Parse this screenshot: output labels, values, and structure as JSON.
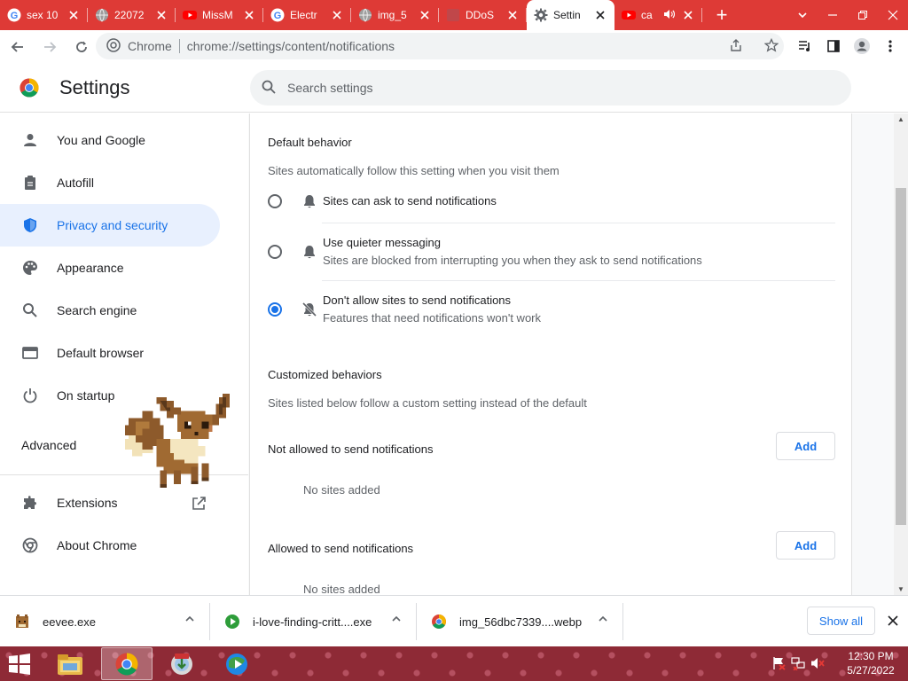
{
  "tabs": [
    {
      "title": "sex 10",
      "favicon": "google-icon",
      "color": "#4285f4"
    },
    {
      "title": "22072",
      "favicon": "globe-icon",
      "color": "#9e9e9e"
    },
    {
      "title": "MissM",
      "favicon": "youtube-icon",
      "color": "#ff0000"
    },
    {
      "title": "Electr",
      "favicon": "google-icon",
      "color": "#4285f4"
    },
    {
      "title": "img_5",
      "favicon": "globe-icon",
      "color": "#9e9e9e"
    },
    {
      "title": "DDoS",
      "favicon": "blank-icon",
      "color": "#c0474a"
    },
    {
      "title": "Settin",
      "favicon": "gear-icon",
      "color": "#5f6368",
      "active": true
    },
    {
      "title": "ca",
      "favicon": "youtube-icon",
      "color": "#ff0000"
    }
  ],
  "omnibox": {
    "site": "Chrome",
    "url": "chrome://settings/content/notifications"
  },
  "settings": {
    "title": "Settings",
    "search_placeholder": "Search settings"
  },
  "sidebar": {
    "items": [
      {
        "label": "You and Google",
        "icon": "person-icon"
      },
      {
        "label": "Autofill",
        "icon": "clipboard-icon"
      },
      {
        "label": "Privacy and security",
        "icon": "shield-icon",
        "active": true
      },
      {
        "label": "Appearance",
        "icon": "palette-icon"
      },
      {
        "label": "Search engine",
        "icon": "search-icon"
      },
      {
        "label": "Default browser",
        "icon": "browser-icon"
      },
      {
        "label": "On startup",
        "icon": "power-icon"
      }
    ],
    "advanced": "Advanced",
    "extensions": "Extensions",
    "about": "About Chrome"
  },
  "content": {
    "default_title": "Default behavior",
    "default_sub": "Sites automatically follow this setting when you visit them",
    "options": [
      {
        "label": "Sites can ask to send notifications",
        "sub": "",
        "selected": false
      },
      {
        "label": "Use quieter messaging",
        "sub": "Sites are blocked from interrupting you when they ask to send notifications",
        "selected": false
      },
      {
        "label": "Don't allow sites to send notifications",
        "sub": "Features that need notifications won't work",
        "selected": true
      }
    ],
    "custom_title": "Customized behaviors",
    "custom_sub": "Sites listed below follow a custom setting instead of the default",
    "not_allowed_label": "Not allowed to send notifications",
    "allowed_label": "Allowed to send notifications",
    "add_label": "Add",
    "no_sites": "No sites added"
  },
  "downloads": {
    "items": [
      {
        "name": "eevee.exe"
      },
      {
        "name": "i-love-finding-critt....exe"
      },
      {
        "name": "img_56dbc7339....webp"
      }
    ],
    "show_all": "Show all"
  },
  "taskbar": {
    "time": "12:30 PM",
    "date": "5/27/2022"
  }
}
